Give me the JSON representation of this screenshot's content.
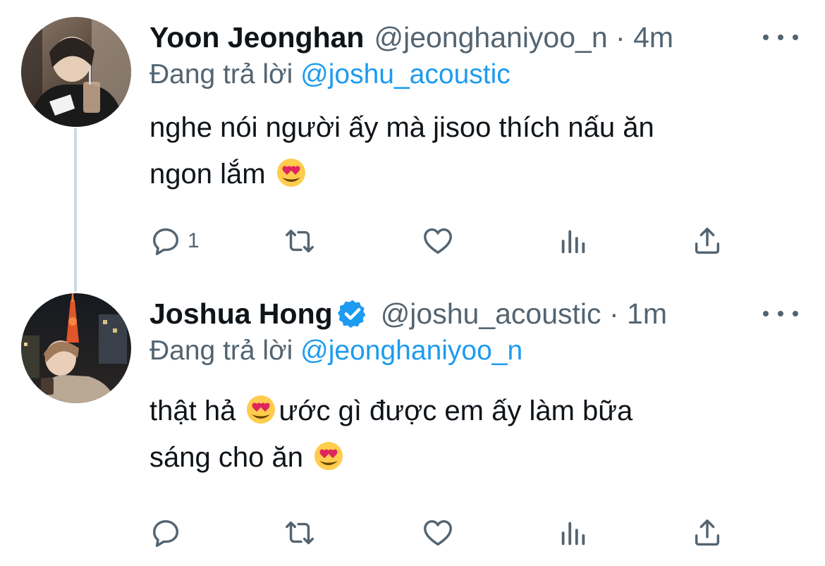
{
  "tweets": [
    {
      "name": "Yoon Jeonghan",
      "handle": "@jeonghaniyoo_n",
      "separator": "·",
      "time": "4m",
      "verified": false,
      "reply_prefix": "Đang trả lời",
      "reply_mention": "@joshu_acoustic",
      "text_lines": [
        "nghe nói người ấy mà jisoo thích nấu ăn",
        "ngon lắm"
      ],
      "reply_count": "1"
    },
    {
      "name": "Joshua Hong",
      "handle": "@joshu_acoustic",
      "separator": "·",
      "time": "1m",
      "verified": true,
      "reply_prefix": "Đang trả lời",
      "reply_mention": "@jeonghaniyoo_n",
      "text_line1_a": "thật hả",
      "text_line1_b": "ước gì được em ấy làm bữa",
      "text_line2": "sáng cho ăn",
      "reply_count": ""
    }
  ],
  "colors": {
    "text": "#0f1419",
    "secondary": "#536471",
    "accent": "#1d9bf0",
    "thread_line": "#cfd9de"
  },
  "icons": {
    "reply": "reply-icon",
    "retweet": "retweet-icon",
    "like": "heart-icon",
    "views": "views-icon",
    "share": "share-icon",
    "more": "more-icon",
    "verified": "verified-badge-icon",
    "emoji": "heart-eyes-emoji"
  }
}
